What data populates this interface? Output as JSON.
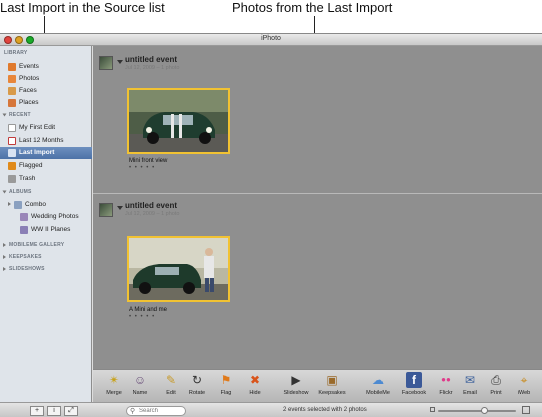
{
  "callouts": {
    "source_list": "Last Import in the Source list",
    "last_import_photos": "Photos from the Last Import"
  },
  "window": {
    "title": "iPhoto"
  },
  "sidebar": {
    "sections": {
      "library": "LIBRARY",
      "recent": "RECENT",
      "albums": "ALBUMS",
      "mobileme": "MOBILEME GALLERY",
      "keepsakes": "KEEPSAKES",
      "slideshows": "SLIDESHOWS"
    },
    "library_items": [
      {
        "label": "Events",
        "color": "#e07a2d"
      },
      {
        "label": "Photos",
        "color": "#e8863a"
      },
      {
        "label": "Faces",
        "color": "#d89a4a"
      },
      {
        "label": "Places",
        "color": "#d6763a"
      }
    ],
    "recent_items": [
      {
        "label": "My First Edit",
        "color": "#b9b9b9"
      },
      {
        "label": "Last 12 Months",
        "color": "#c23b3b"
      },
      {
        "label": "Last Import",
        "color": "#6f8db8"
      },
      {
        "label": "Flagged",
        "color": "#e08a1a"
      },
      {
        "label": "Trash",
        "color": "#9a9a9a"
      }
    ],
    "album_items": [
      {
        "label": "Combo",
        "color": "#8aa0c0"
      },
      {
        "label": "Wedding Photos",
        "color": "#9a86b8"
      },
      {
        "label": "WW II Planes",
        "color": "#8a7fb5"
      }
    ]
  },
  "events": [
    {
      "title": "untitled event",
      "subtitle": "Jul 12, 2009 – 1 photo",
      "photo_caption": "Mini front view",
      "stars": "• • • • •"
    },
    {
      "title": "untitled event",
      "subtitle": "Jul 12, 2009 – 1 photo",
      "photo_caption": "A Mini and me",
      "stars": "• • • • •"
    }
  ],
  "toolbar": [
    {
      "label": "Merge",
      "icon": "merge-icon",
      "glyph": "✴"
    },
    {
      "label": "Name",
      "icon": "name-icon",
      "glyph": "☺"
    },
    {
      "label": "Edit",
      "icon": "edit-icon",
      "glyph": "✎"
    },
    {
      "label": "Rotate",
      "icon": "rotate-icon",
      "glyph": "↻"
    },
    {
      "label": "Flag",
      "icon": "flag-icon",
      "glyph": "⚑"
    },
    {
      "label": "Hide",
      "icon": "hide-icon",
      "glyph": "✖"
    },
    {
      "label": "Slideshow",
      "icon": "slideshow-icon",
      "glyph": "▶"
    },
    {
      "label": "Keepsakes",
      "icon": "keepsakes-icon",
      "glyph": "▣"
    },
    {
      "label": "MobileMe",
      "icon": "mobileme-icon",
      "glyph": "☁"
    },
    {
      "label": "Facebook",
      "icon": "facebook-icon",
      "glyph": "f"
    },
    {
      "label": "Flickr",
      "icon": "flickr-icon",
      "glyph": "●●"
    },
    {
      "label": "Email",
      "icon": "email-icon",
      "glyph": "✉"
    },
    {
      "label": "Print",
      "icon": "print-icon",
      "glyph": "⎙"
    },
    {
      "label": "iWeb",
      "icon": "iweb-icon",
      "glyph": "⌖"
    }
  ],
  "statusbar": {
    "add_glyph": "+",
    "info_glyph": "i",
    "fullscreen_glyph": "⤢",
    "search_placeholder": "Search",
    "status_text": "2 events selected with 2 photos",
    "zoom_level": 0.6
  },
  "colors": {
    "selection": "#4d72a7",
    "photo_border": "#f1c232",
    "main_bg": "#8f8f8f"
  }
}
